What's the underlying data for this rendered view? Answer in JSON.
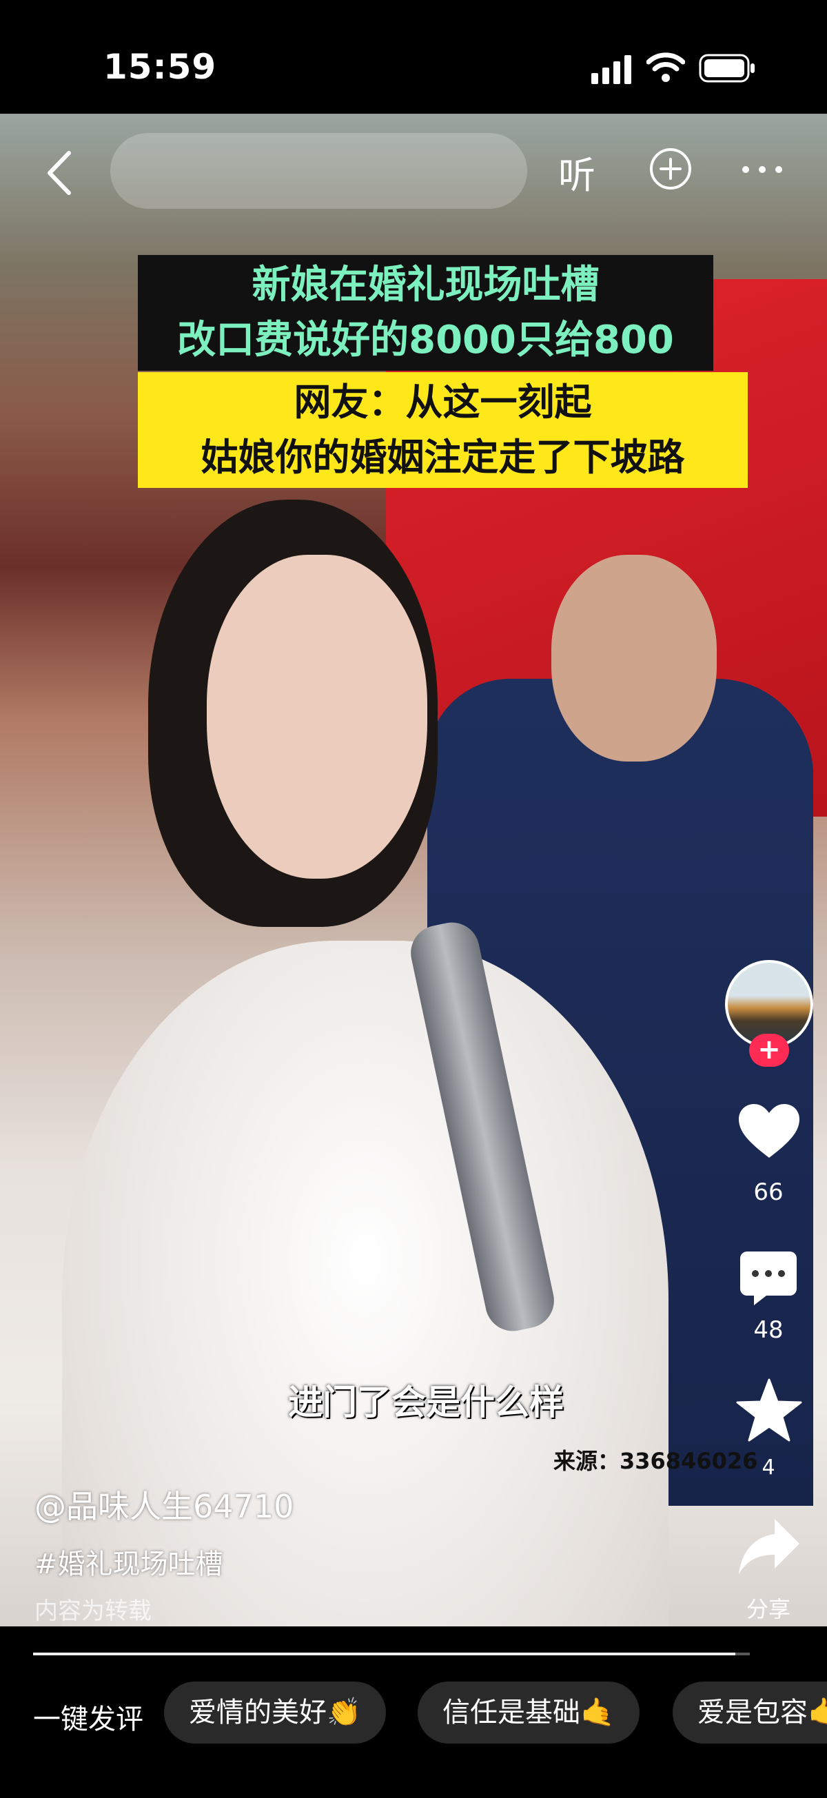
{
  "status_bar": {
    "time": "15:59"
  },
  "nav": {
    "listen_label": "听"
  },
  "captions": {
    "dark_line1": "新娘在婚礼现场吐槽",
    "dark_line2": "改口费说好的8000只给800",
    "yellow_line1": "网友：从这一刻起",
    "yellow_line2": "姑娘你的婚姻注定走了下坡路"
  },
  "subtitle": "进门了会是什么样",
  "source": "来源：336846026",
  "actions": {
    "follow": "+",
    "likes": "66",
    "comments": "48",
    "favorites": "4",
    "share": "分享"
  },
  "post": {
    "author": "@品味人生64710",
    "hashtag": "#婚礼现场吐槽",
    "repost_note": "内容为转载"
  },
  "progress": {
    "fraction": 0.98
  },
  "comment_bar": {
    "quick_label": "一键发评",
    "chips": [
      "爱情的美好👏",
      "信任是基础🤙",
      "爱是包容🤙"
    ]
  }
}
